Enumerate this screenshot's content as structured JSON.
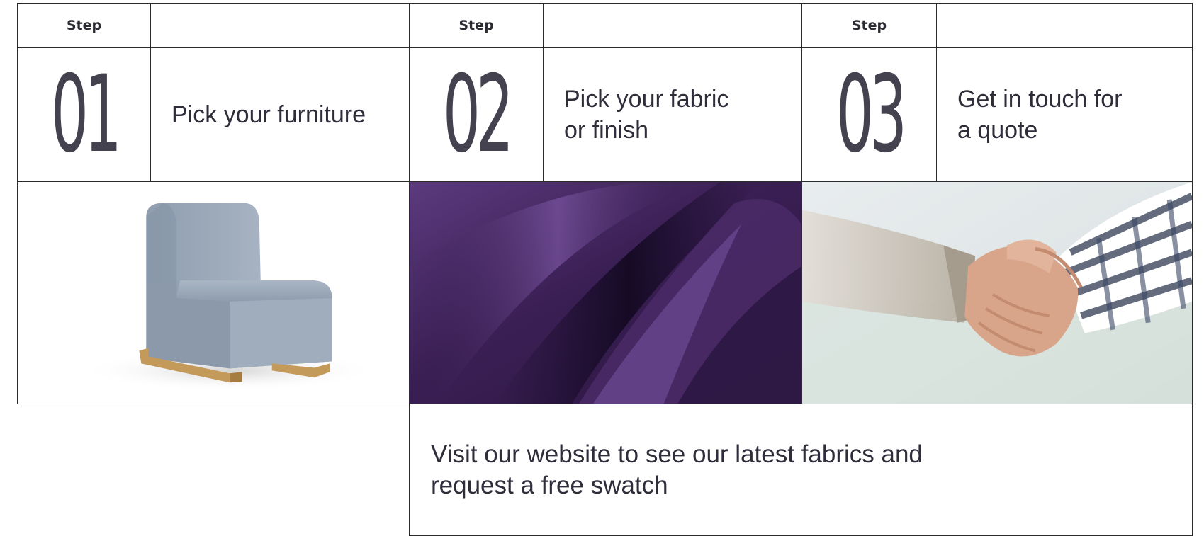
{
  "steps": [
    {
      "label": "Step",
      "number": "01",
      "text": "Pick your furniture",
      "image": "blue-armless-chair"
    },
    {
      "label": "Step",
      "number": "02",
      "text": "Pick your fabric\nor finish",
      "image": "purple-leather-fabric"
    },
    {
      "label": "Step",
      "number": "03",
      "text": "Get in touch for\na quote",
      "image": "business-handshake"
    }
  ],
  "cta": {
    "text": "Visit our website to see our latest fabrics and\nrequest a free swatch"
  },
  "colors": {
    "number": "#45424f",
    "text": "#2f2d3a",
    "border": "#2b2b2b",
    "fabric": "#4a2a66"
  }
}
